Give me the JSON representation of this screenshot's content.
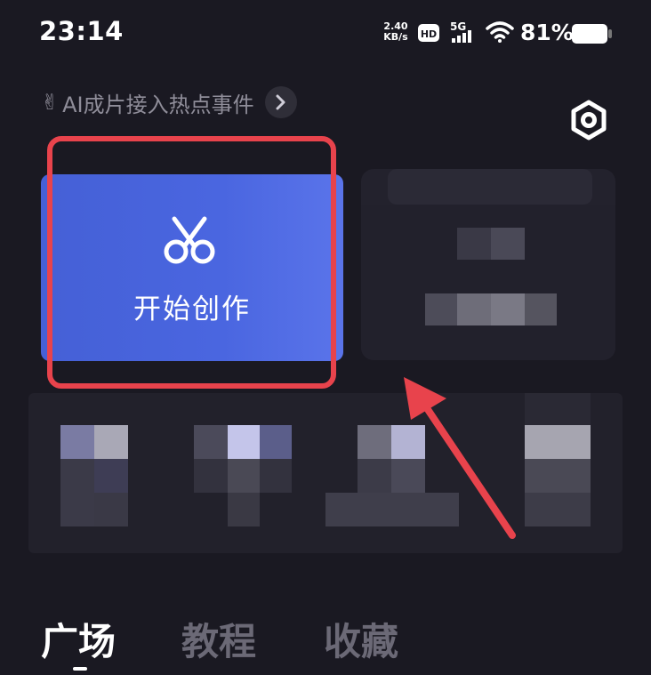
{
  "status_bar": {
    "time": "23:14",
    "net_speed_value": "2.40",
    "net_speed_unit": "KB/s",
    "hd_badge": "HD",
    "network": "5G",
    "battery_percent": "81%"
  },
  "hot_event": {
    "emoji": "✌",
    "text": "AI成片接入热点事件"
  },
  "create_card": {
    "label": "开始创作"
  },
  "tabs": [
    {
      "label": "广场",
      "active": true
    },
    {
      "label": "教程",
      "active": false
    },
    {
      "label": "收藏",
      "active": false
    }
  ],
  "colors": {
    "background": "#1a1922",
    "card_blue": "#4a66e0",
    "highlight_red": "#e8434c",
    "tab_inactive": "#6b6976"
  }
}
